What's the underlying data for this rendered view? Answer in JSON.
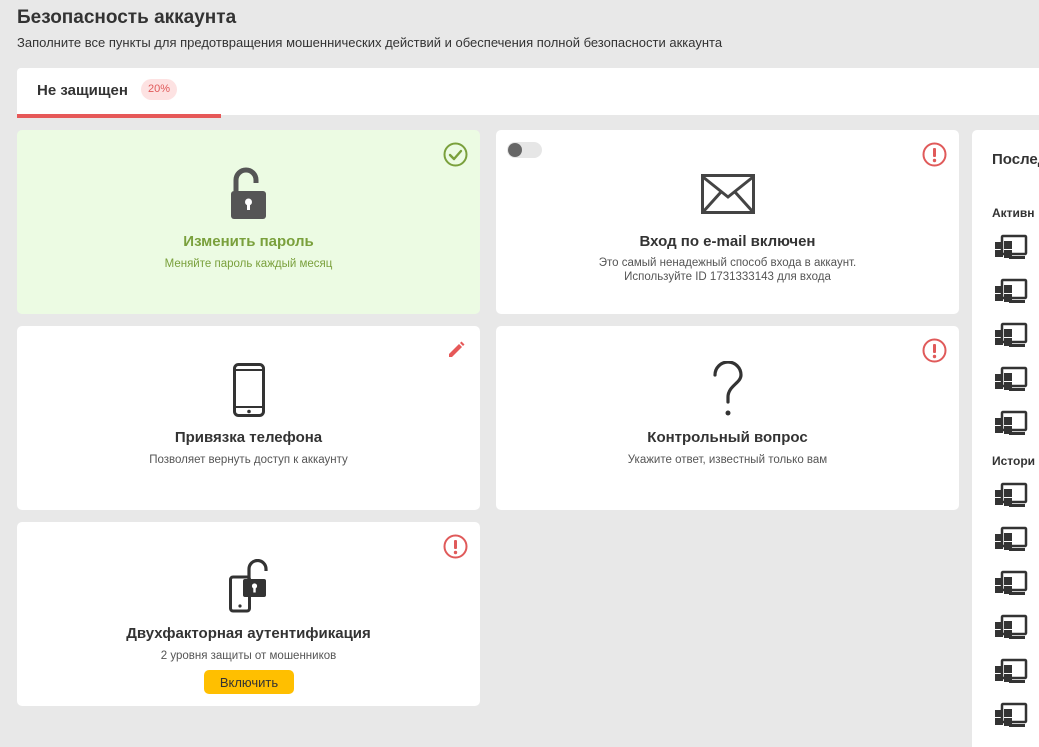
{
  "header": {
    "title": "Безопасность аккаунта",
    "subtitle": "Заполните все пункты для предотвращения мошеннических действий и обеспечения полной безопасности аккаунта"
  },
  "status": {
    "label": "Не защищен",
    "badge": "20%",
    "progress": 0.2,
    "color": "#e65858"
  },
  "cards": {
    "password": {
      "title": "Изменить пароль",
      "desc": "Меняйте пароль каждый месяц",
      "state": "done",
      "icon": "padlock-open-icon"
    },
    "email": {
      "title": "Вход по e-mail включен",
      "desc_line1": "Это самый ненадежный способ входа в аккаунт.",
      "desc_line2": "Используйте ID 1731333143 для входа",
      "state": "warning",
      "icon": "envelope-icon",
      "toggle_on": false
    },
    "phone": {
      "title": "Привязка телефона",
      "desc": "Позволяет вернуть доступ к аккаунту",
      "state": "edit",
      "icon": "smartphone-icon"
    },
    "question": {
      "title": "Контрольный вопрос",
      "desc": "Укажите ответ, известный только вам",
      "state": "warning",
      "icon": "question-mark-icon"
    },
    "twofa": {
      "title": "Двухфакторная аутентификация",
      "desc": "2 уровня защиты от мошенников",
      "button": "Включить",
      "state": "warning",
      "icon": "phone-lock-icon"
    }
  },
  "sidebar": {
    "title": "Послед",
    "active_label": "Активн",
    "history_label": "Истори",
    "session_icon": "windows-desktop-icon"
  },
  "colors": {
    "success": "#7aa03c",
    "warning": "#e05a5a",
    "accent": "#ffbf00"
  }
}
